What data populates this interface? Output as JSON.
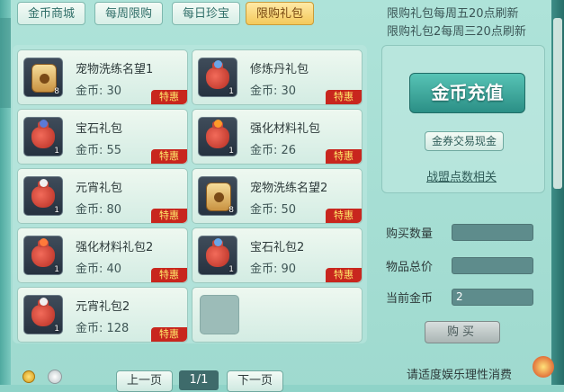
{
  "tabs": [
    {
      "label": "金币商城",
      "active": false
    },
    {
      "label": "每周限购",
      "active": false
    },
    {
      "label": "每日珍宝",
      "active": false
    },
    {
      "label": "限购礼包",
      "active": true
    }
  ],
  "info": {
    "line1": "限购礼包每周五20点刷新",
    "line2": "限购礼包2每周三20点刷新"
  },
  "items": [
    {
      "name": "宠物洗练名望1",
      "price": "金币: 30",
      "tag": "特惠",
      "qty": "8",
      "icon": "paw-token-icon"
    },
    {
      "name": "修炼丹礼包",
      "price": "金币: 30",
      "tag": "特惠",
      "qty": "1",
      "icon": "red-gift-bag-icon"
    },
    {
      "name": "宝石礼包",
      "price": "金币: 55",
      "tag": "特惠",
      "qty": "1",
      "icon": "red-gift-bag-icon"
    },
    {
      "name": "强化材料礼包",
      "price": "金币: 26",
      "tag": "特惠",
      "qty": "1",
      "icon": "red-gift-bag-icon"
    },
    {
      "name": "元宵礼包",
      "price": "金币: 80",
      "tag": "特惠",
      "qty": "1",
      "icon": "red-gift-bag-icon"
    },
    {
      "name": "宠物洗练名望2",
      "price": "金币: 50",
      "tag": "特惠",
      "qty": "8",
      "icon": "paw-token-icon"
    },
    {
      "name": "强化材料礼包2",
      "price": "金币: 40",
      "tag": "特惠",
      "qty": "1",
      "icon": "red-gift-bag-icon"
    },
    {
      "name": "宝石礼包2",
      "price": "金币: 90",
      "tag": "特惠",
      "qty": "1",
      "icon": "red-gift-bag-icon"
    },
    {
      "name": "元宵礼包2",
      "price": "金币: 128",
      "tag": "特惠",
      "qty": "1",
      "icon": "red-gift-bag-icon"
    }
  ],
  "gem_colors": [
    "#6aa6e8",
    "#ff9a2a",
    "#e0e0e0",
    "#ff7a3a",
    "#5a7ad8",
    "#f0f0f0"
  ],
  "panel": {
    "recharge_label": "金币充值",
    "trade_label": "金券交易现金",
    "union_link": "战盟点数相关"
  },
  "form": {
    "qty_label": "购买数量",
    "qty_value": "",
    "total_label": "物品总价",
    "total_value": "",
    "current_label": "当前金币",
    "current_value": "2",
    "buy_label": "购买"
  },
  "pager": {
    "prev_label": "上一页",
    "page_text": "1/1",
    "next_label": "下一页"
  },
  "footer": {
    "note": "请适度娱乐理性消费"
  },
  "colors": {
    "tag_bg": "#c8261e",
    "tag_text": "#ffe76a",
    "active_tab": "#f4c95a",
    "recharge_btn": "#2b8f86"
  }
}
